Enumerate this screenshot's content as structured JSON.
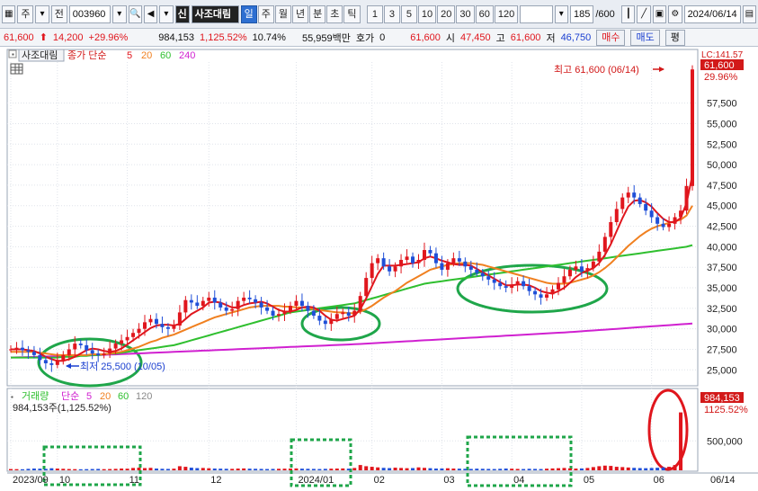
{
  "toolbar": {
    "market_label": "주",
    "all_label": "전",
    "code_value": "003960",
    "mark_label": "신",
    "stock_name": "사조대림",
    "period_buttons": [
      "일",
      "주",
      "월",
      "년",
      "분",
      "초",
      "틱"
    ],
    "active_period": "일",
    "interval_buttons": [
      "1",
      "3",
      "5",
      "10",
      "20",
      "30",
      "60",
      "120"
    ],
    "count_value": "185",
    "count_total": "/600",
    "date_value": "2024/06/14"
  },
  "quote": {
    "price": "61,600",
    "change": "14,200",
    "change_pct": "+29.96%",
    "volume": "984,153",
    "volume_pct": "1,125.52%",
    "turnover_pct": "10.74%",
    "amount": "55,959백만",
    "hoga_label": "호가",
    "hoga_value": "0",
    "ask_price": "61,600",
    "open_label": "시",
    "open_value": "47,450",
    "high_label": "고",
    "high_value": "61,600",
    "low_label": "저",
    "low_value": "46,750",
    "buy_label": "매수",
    "sell_label": "매도",
    "compare_label": "평"
  },
  "price_panel": {
    "legend_name": "사조대림",
    "legend_ma_label": "종가 단순",
    "legend_periods": [
      "5",
      "20",
      "60",
      "240"
    ],
    "lc_label": "LC:141.57",
    "last_price": "61,600",
    "last_pct": "29.96%",
    "high_annotation": "최고 61,600 (06/14)",
    "low_annotation": "최저 25,500 (10/05)"
  },
  "volume_panel": {
    "legend_title": "거래량",
    "legend_ma_label": "단순",
    "legend_periods": [
      "5",
      "20",
      "60",
      "120"
    ],
    "legend_value": "984,153주(1,125.52%)",
    "last_volume": "984,153",
    "last_pct": "1125.52%"
  },
  "chart_data": {
    "type": "candlestick",
    "x_labels": [
      "2023/09",
      "10",
      "11",
      "12",
      "2024/01",
      "02",
      "03",
      "04",
      "05",
      "06"
    ],
    "x_label_right": "06/14",
    "y_ticks": [
      "57,500",
      "55,000",
      "52,500",
      "50,000",
      "47,500",
      "45,000",
      "42,500",
      "40,000",
      "37,500",
      "35,000",
      "32,500",
      "30,000",
      "27,500",
      "25,000"
    ],
    "ylim": [
      23500,
      62500
    ],
    "volume_ticks": [
      "500,000"
    ],
    "volume_ylim": [
      0,
      1100000
    ],
    "close_series": [
      27500,
      27700,
      27400,
      27200,
      26800,
      26200,
      25800,
      25600,
      26200,
      26800,
      27500,
      28200,
      28000,
      27400,
      27000,
      26800,
      27000,
      27600,
      28200,
      28600,
      29000,
      29500,
      30000,
      30800,
      31200,
      30600,
      30200,
      30000,
      30400,
      32000,
      33500,
      33200,
      32800,
      33400,
      33800,
      33200,
      32600,
      32200,
      32400,
      33400,
      33800,
      33600,
      33200,
      32600,
      32200,
      31600,
      31800,
      32200,
      32800,
      33400,
      32800,
      32200,
      31600,
      31000,
      30600,
      31200,
      31800,
      32000,
      31600,
      32200,
      34000,
      36200,
      38000,
      38600,
      37600,
      37000,
      37600,
      38400,
      38800,
      38000,
      38400,
      39600,
      39200,
      38000,
      37200,
      38000,
      38600,
      38200,
      37600,
      37200,
      36800,
      36400,
      36000,
      35600,
      35200,
      35000,
      35400,
      35800,
      35200,
      34600,
      34200,
      33800,
      34200,
      34800,
      35600,
      36400,
      37200,
      37600,
      37000,
      37400,
      38200,
      39400,
      41200,
      43000,
      44600,
      46000,
      46600,
      46000,
      45200,
      44400,
      43600,
      42800,
      42400,
      42800,
      43600,
      44400,
      47400,
      61600
    ],
    "ma5": [
      27500,
      27500,
      27500,
      27400,
      27300,
      27000,
      26600,
      26300,
      26100,
      26100,
      26300,
      26600,
      27000,
      27400,
      27600,
      27500,
      27300,
      27200,
      27300,
      27600,
      28100,
      28600,
      29100,
      29600,
      30100,
      30400,
      30500,
      30500,
      30400,
      30600,
      31200,
      31800,
      32200,
      32600,
      33200,
      33300,
      33200,
      32900,
      32600,
      32600,
      32900,
      33100,
      33200,
      33300,
      33100,
      32700,
      32300,
      32100,
      32100,
      32300,
      32600,
      32700,
      32600,
      32200,
      31600,
      31100,
      31000,
      31200,
      31400,
      31600,
      32400,
      33700,
      35200,
      36700,
      37700,
      37700,
      37700,
      37800,
      37900,
      38000,
      38100,
      38600,
      38800,
      38600,
      38300,
      38100,
      37900,
      37800,
      37800,
      37700,
      37300,
      36900,
      36500,
      36100,
      35700,
      35300,
      35300,
      35400,
      35400,
      35300,
      35000,
      34600,
      34400,
      34300,
      34600,
      35000,
      35600,
      36300,
      36800,
      37100,
      37400,
      38000,
      39000,
      40300,
      41900,
      43500,
      44900,
      45600,
      45700,
      45400,
      44900,
      44100,
      43400,
      43000,
      43000,
      43500,
      45300,
      48700
    ],
    "ma20": [
      27200,
      27200,
      27200,
      27200,
      27200,
      27100,
      27000,
      26900,
      26800,
      26800,
      26800,
      26800,
      26800,
      26800,
      26900,
      26900,
      26900,
      27000,
      27100,
      27200,
      27400,
      27600,
      27800,
      28100,
      28400,
      28600,
      28900,
      29100,
      29300,
      29600,
      29900,
      30200,
      30500,
      30800,
      31100,
      31400,
      31600,
      31800,
      32000,
      32200,
      32400,
      32600,
      32700,
      32800,
      32800,
      32800,
      32800,
      32700,
      32700,
      32600,
      32600,
      32500,
      32400,
      32300,
      32200,
      32100,
      32000,
      32000,
      31900,
      31900,
      32100,
      32400,
      32800,
      33300,
      33800,
      34200,
      34600,
      35100,
      35600,
      36000,
      36400,
      36800,
      37200,
      37400,
      37600,
      37800,
      37900,
      38000,
      38000,
      38000,
      37900,
      37800,
      37600,
      37400,
      37200,
      37000,
      36800,
      36600,
      36400,
      36200,
      36000,
      35800,
      35600,
      35500,
      35500,
      35500,
      35600,
      35800,
      36000,
      36200,
      36500,
      36900,
      37400,
      38000,
      38700,
      39400,
      40100,
      40700,
      41300,
      41800,
      42200,
      42500,
      42700,
      42900,
      43100,
      43300,
      43800,
      45000
    ],
    "ma60": [
      26500,
      26500,
      26500,
      26500,
      26500,
      26500,
      26500,
      26500,
      26500,
      26600,
      26600,
      26600,
      26700,
      26700,
      26800,
      26800,
      26900,
      27000,
      27000,
      27100,
      27200,
      27300,
      27400,
      27500,
      27600,
      27700,
      27800,
      27900,
      28000,
      28200,
      28400,
      28600,
      28800,
      29000,
      29200,
      29400,
      29600,
      29800,
      30000,
      30200,
      30400,
      30600,
      30800,
      31000,
      31200,
      31400,
      31600,
      31800,
      32000,
      32100,
      32200,
      32300,
      32400,
      32500,
      32600,
      32700,
      32800,
      32900,
      33000,
      33100,
      33300,
      33500,
      33700,
      33900,
      34100,
      34300,
      34500,
      34700,
      34900,
      35100,
      35300,
      35500,
      35600,
      35700,
      35800,
      35900,
      36000,
      36100,
      36200,
      36300,
      36400,
      36500,
      36600,
      36700,
      36800,
      36900,
      37000,
      37100,
      37200,
      37300,
      37400,
      37500,
      37600,
      37700,
      37800,
      37900,
      38000,
      38100,
      38200,
      38300,
      38400,
      38500,
      38600,
      38700,
      38800,
      38900,
      39000,
      39100,
      39200,
      39300,
      39400,
      39500,
      39600,
      39700,
      39800,
      39900,
      40000,
      40200
    ],
    "ma240": [
      26500,
      26520,
      26540,
      26560,
      26580,
      26600,
      26620,
      26640,
      26660,
      26680,
      26700,
      26720,
      26740,
      26760,
      26780,
      26800,
      26830,
      26860,
      26890,
      26920,
      26950,
      26980,
      27010,
      27040,
      27070,
      27100,
      27130,
      27160,
      27190,
      27220,
      27250,
      27280,
      27310,
      27340,
      27370,
      27400,
      27430,
      27460,
      27490,
      27520,
      27550,
      27580,
      27610,
      27640,
      27670,
      27700,
      27730,
      27760,
      27790,
      27820,
      27850,
      27880,
      27910,
      27940,
      27970,
      28000,
      28030,
      28060,
      28090,
      28120,
      28160,
      28200,
      28240,
      28280,
      28320,
      28360,
      28400,
      28440,
      28480,
      28520,
      28560,
      28600,
      28640,
      28680,
      28720,
      28760,
      28800,
      28840,
      28880,
      28920,
      28960,
      29000,
      29040,
      29080,
      29120,
      29160,
      29200,
      29240,
      29280,
      29320,
      29360,
      29400,
      29440,
      29480,
      29520,
      29560,
      29600,
      29650,
      29700,
      29750,
      29800,
      29850,
      29900,
      29950,
      30000,
      30050,
      30100,
      30150,
      30200,
      30250,
      30300,
      30350,
      30400,
      30450,
      30500,
      30550,
      30600,
      30650
    ],
    "volumes": [
      22000,
      20000,
      18000,
      25000,
      30000,
      28000,
      24000,
      35000,
      30000,
      26000,
      22000,
      20000,
      18000,
      20000,
      22000,
      24000,
      20000,
      22000,
      25000,
      30000,
      28000,
      40000,
      45000,
      38000,
      42000,
      30000,
      26000,
      24000,
      28000,
      70000,
      60000,
      45000,
      38000,
      40000,
      35000,
      30000,
      28000,
      26000,
      25000,
      30000,
      32000,
      28000,
      26000,
      24000,
      22000,
      24000,
      26000,
      28000,
      30000,
      32000,
      28000,
      26000,
      24000,
      22000,
      25000,
      28000,
      30000,
      32000,
      28000,
      40000,
      90000,
      70000,
      60000,
      50000,
      42000,
      38000,
      45000,
      40000,
      36000,
      38000,
      50000,
      42000,
      36000,
      30000,
      32000,
      35000,
      30000,
      28000,
      26000,
      24000,
      28000,
      26000,
      24000,
      22000,
      26000,
      30000,
      28000,
      24000,
      22000,
      26000,
      24000,
      22000,
      28000,
      32000,
      36000,
      40000,
      34000,
      30000,
      32000,
      40000,
      55000,
      70000,
      80000,
      75000,
      60000,
      55000,
      48000,
      42000,
      38000,
      36000,
      40000,
      44000,
      50000,
      60000,
      90000,
      984153
    ]
  }
}
